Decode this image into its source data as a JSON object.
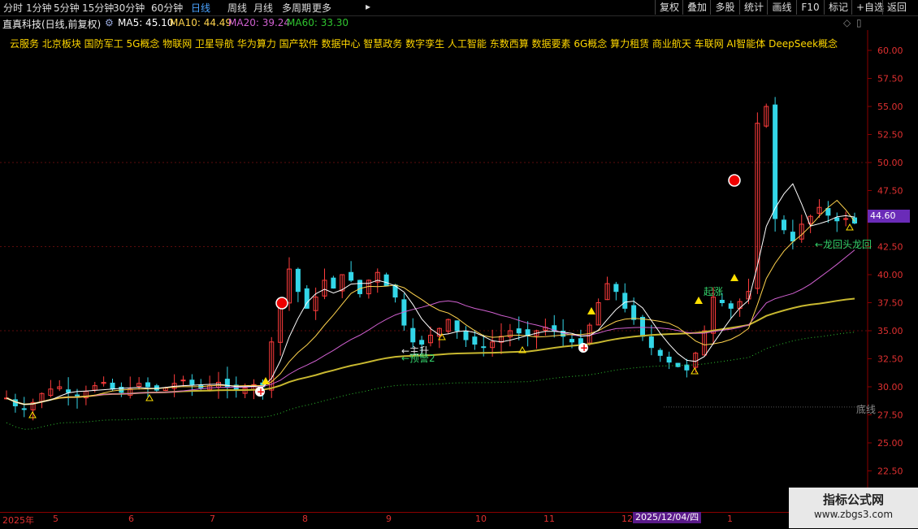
{
  "toolbar": {
    "periods": [
      "分时",
      "1分钟",
      "5分钟",
      "15分钟",
      "30分钟",
      "60分钟",
      "日线",
      "周线",
      "月线",
      "多周期",
      "更多"
    ],
    "active_period": "日线",
    "right_buttons": [
      "复权",
      "叠加",
      "多股",
      "统计",
      "画线",
      "F10",
      "标记",
      "+自选",
      "返回"
    ]
  },
  "title": {
    "stock": "直真科技(日线,前复权)",
    "ma5": "MA5: 45.10",
    "ma10": "MA10: 44.49",
    "ma20": "MA20: 39.24",
    "ma60": "MA60: 33.30"
  },
  "concepts": "云服务 北京板块 国防军工 5G概念 物联网 卫星导航 华为算力 国产软件 数据中心 智慧政务 数字孪生 人工智能 东数西算 数据要素 6G概念 算力租赁 商业航天 车联网 AI智能体 DeepSeek概念",
  "y_axis_labels": [
    "60.00",
    "57.50",
    "55.00",
    "52.50",
    "50.00",
    "47.50",
    "45.00",
    "42.50",
    "40.00",
    "37.50",
    "35.00",
    "32.50",
    "30.00",
    "27.50",
    "25.00",
    "22.50"
  ],
  "current_price": "44.60",
  "x_axis_labels": [
    "2025年",
    "5",
    "6",
    "7",
    "8",
    "9",
    "10",
    "11",
    "12",
    "1"
  ],
  "cursor_date": "2025/12/04/四",
  "annotations": {
    "upgrade": "←主升",
    "warning": "←预警2",
    "rise": "起涨",
    "dragon": "←龙回头龙回",
    "bottom": "底线"
  },
  "watermark": {
    "line1": "指标公式网",
    "line2": "www.zbgs3.com"
  },
  "colors": {
    "up": "#ff3c3c",
    "down": "#33d6e8",
    "ma5": "#ffffff",
    "ma10": "#ffd34d",
    "ma20": "#d060d0",
    "ma60": "#2fc42f",
    "accent": "#4aa3ff"
  },
  "chart_data": {
    "type": "candlestick",
    "title": "直真科技(日线,前复权)",
    "ylim": [
      21.0,
      62.5
    ],
    "yticks": [
      22.5,
      25,
      27.5,
      30,
      32.5,
      35,
      37.5,
      40,
      42.5,
      45,
      47.5,
      50,
      52.5,
      55,
      57.5,
      60
    ],
    "months": [
      "2025年",
      "5",
      "6",
      "7",
      "8",
      "9",
      "10",
      "11",
      "12",
      "1"
    ],
    "close_path_approx": [
      29.0,
      28.3,
      28.0,
      28.6,
      29.4,
      29.8,
      30.0,
      29.5,
      29.2,
      29.6,
      30.1,
      30.3,
      29.8,
      29.5,
      29.8,
      30.3,
      30.0,
      29.7,
      29.9,
      30.3,
      30.6,
      30.2,
      29.9,
      30.1,
      30.4,
      30.0,
      29.7,
      29.9,
      30.2,
      30.0,
      34.0,
      37.5,
      40.5,
      38.5,
      37.0,
      38.0,
      39.5,
      38.8,
      40.0,
      39.5,
      38.3,
      39.5,
      40.2,
      39.0,
      38.0,
      35.5,
      34.0,
      33.8,
      34.6,
      35.2,
      36.0,
      35.0,
      34.2,
      33.8,
      33.5,
      34.0,
      34.5,
      35.0,
      34.8,
      34.6,
      35.0,
      35.3,
      35.0,
      34.5,
      34.0,
      33.8,
      35.5,
      37.5,
      39.2,
      38.5,
      37.0,
      36.0,
      34.5,
      33.5,
      32.8,
      32.2,
      31.8,
      31.5,
      33.0,
      35.0,
      38.0,
      37.5,
      37.0,
      37.6,
      38.5,
      53.5,
      55.0,
      45.0,
      44.0,
      43.0,
      44.5,
      45.2,
      46.0,
      45.3,
      44.8,
      45.0,
      44.6
    ],
    "ma5_last": 45.1,
    "ma10_last": 44.49,
    "ma20_last": 39.24,
    "ma60_last": 33.3,
    "current_price": 44.6
  }
}
